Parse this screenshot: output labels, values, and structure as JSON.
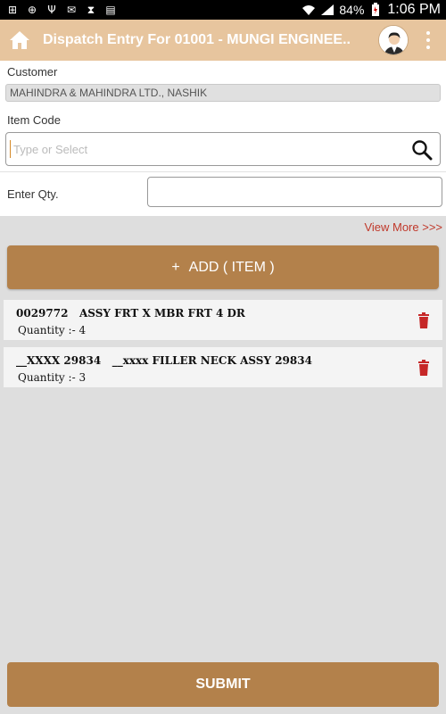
{
  "status_bar": {
    "battery": "84%",
    "time": "1:06 PM"
  },
  "app_bar": {
    "title": "Dispatch Entry For 01001 - MUNGI ENGINEE.."
  },
  "form": {
    "customer_label": "Customer",
    "customer_value": "MAHINDRA & MAHINDRA LTD., NASHIK",
    "item_code_label": "Item Code",
    "item_code_placeholder": "Type or Select",
    "qty_label": "Enter Qty."
  },
  "view_more": "View More >>>",
  "add_button": {
    "plus": "+",
    "label": "ADD ( ITEM )"
  },
  "items": [
    {
      "title": "0029772   ASSY FRT X MBR FRT 4 DR",
      "quantity": "Quantity :- 4"
    },
    {
      "title": "__XXXX 29834   __xxxx FILLER NECK ASSY 29834",
      "quantity": "Quantity :- 3"
    }
  ],
  "submit_button": "SUBMIT",
  "colors": {
    "app_bar": "#e7c59e",
    "button": "#b3814b",
    "accent_link": "#c0392b",
    "delete_icon": "#c62828"
  }
}
